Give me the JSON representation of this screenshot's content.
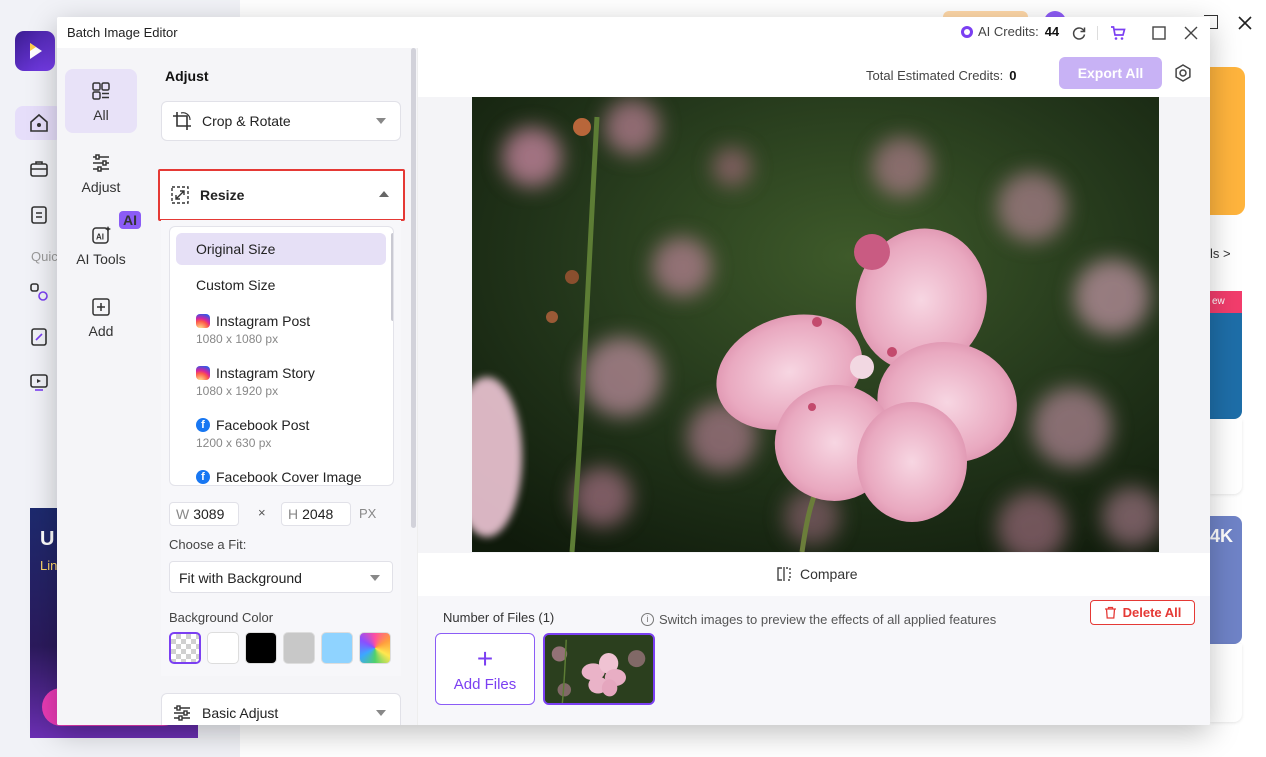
{
  "background_app": {
    "quick_label": "Quic",
    "banner_left_text1": "U",
    "banner_left_text2": "Lin",
    "right_link": "ls >",
    "right_tag": "ew",
    "right_card_text": "4K"
  },
  "window": {
    "title": "Batch Image Editor",
    "credits_label": "AI Credits:",
    "credits_value": "44"
  },
  "rail": {
    "items": [
      {
        "label": "All",
        "icon": "grid-icon"
      },
      {
        "label": "Adjust",
        "icon": "sliders-icon"
      },
      {
        "label": "AI Tools",
        "icon": "ai-icon",
        "badge": "AI"
      },
      {
        "label": "Add",
        "icon": "plus-square-icon"
      }
    ]
  },
  "panel": {
    "title": "Adjust",
    "crop_label": "Crop & Rotate",
    "resize_label": "Resize",
    "basic_adjust_label": "Basic Adjust",
    "sizes": [
      {
        "name": "Original Size",
        "dims": ""
      },
      {
        "name": "Custom Size",
        "dims": ""
      },
      {
        "name": "Instagram Post",
        "dims": "1080 x 1080 px"
      },
      {
        "name": "Instagram Story",
        "dims": "1080 x 1920 px"
      },
      {
        "name": "Facebook Post",
        "dims": "1200 x 630 px"
      },
      {
        "name": "Facebook Cover Image",
        "dims": ""
      }
    ],
    "width_key": "W",
    "width_value": "3089",
    "height_key": "H",
    "height_value": "2048",
    "times": "×",
    "unit": "PX",
    "fit_label": "Choose a Fit:",
    "fit_value": "Fit with Background",
    "bg_color_label": "Background Color"
  },
  "colors": {
    "accent": "#7b3ff2",
    "danger": "#e53935",
    "swatches": [
      "transparent",
      "#ffffff",
      "#000000",
      "#c8c8c8",
      "#8fd3ff",
      "gradient"
    ]
  },
  "main": {
    "est_label": "Total Estimated Credits:",
    "est_value": "0",
    "export_label": "Export All",
    "compare_label": "Compare",
    "files_count": "Number of Files (1)",
    "files_hint": "Switch images to preview the effects of all applied features",
    "delete_all_label": "Delete All",
    "add_files_label": "Add Files"
  }
}
